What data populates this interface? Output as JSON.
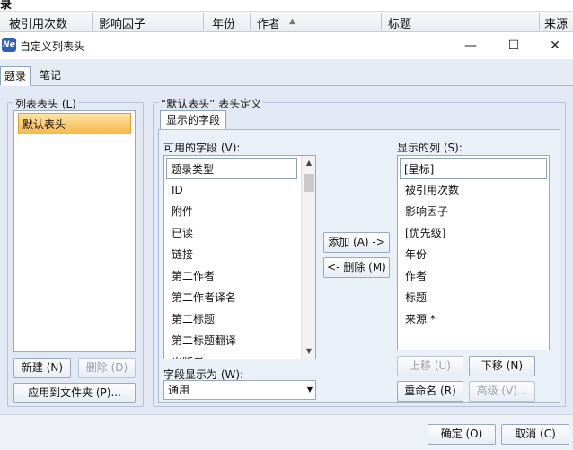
{
  "background_header": {
    "partial_title": "录",
    "columns": [
      "被引用次数",
      "影响因子",
      "年份",
      "作者",
      "标题",
      "来源"
    ],
    "sort_indicator": "▲"
  },
  "window": {
    "icon_text": "Ne",
    "title": "自定义列表头",
    "minimize": "—",
    "maximize": "☐",
    "close": "✕"
  },
  "tabs": [
    "题录",
    "笔记"
  ],
  "left_group": {
    "legend": "列表表头 (L)",
    "items": [
      "默认表头"
    ],
    "new_button": "新建 (N)",
    "delete_button": "删除 (D)",
    "apply_button": "应用到文件夹 (P)..."
  },
  "right_group": {
    "legend": "“默认表头” 表头定义",
    "inner_tab": "显示的字段",
    "available_label": "可用的字段 (V):",
    "available_fields": [
      "题录类型",
      "ID",
      "附件",
      "已读",
      "链接",
      "第二作者",
      "第二作者译名",
      "第二标题",
      "第二标题翻译",
      "出版者"
    ],
    "add_button": "添加 (A) ->",
    "remove_button": "<- 删除 (M)",
    "shown_label": "显示的列 (S):",
    "shown_columns": [
      "[星标]",
      "被引用次数",
      "影响因子",
      "[优先级]",
      "年份",
      "作者",
      "标题",
      "来源 *"
    ],
    "display_as_label": "字段显示为 (W):",
    "display_as_value": "通用",
    "move_up": "上移 (U)",
    "move_down": "下移 (N)",
    "rename": "重命名 (R)",
    "advanced": "高级 (V)..."
  },
  "footer": {
    "ok": "确定 (O)",
    "cancel": "取消 (C)"
  },
  "colors": {
    "accent_selected": "#f7b84a",
    "panel_bg": "#e3e9f4"
  }
}
